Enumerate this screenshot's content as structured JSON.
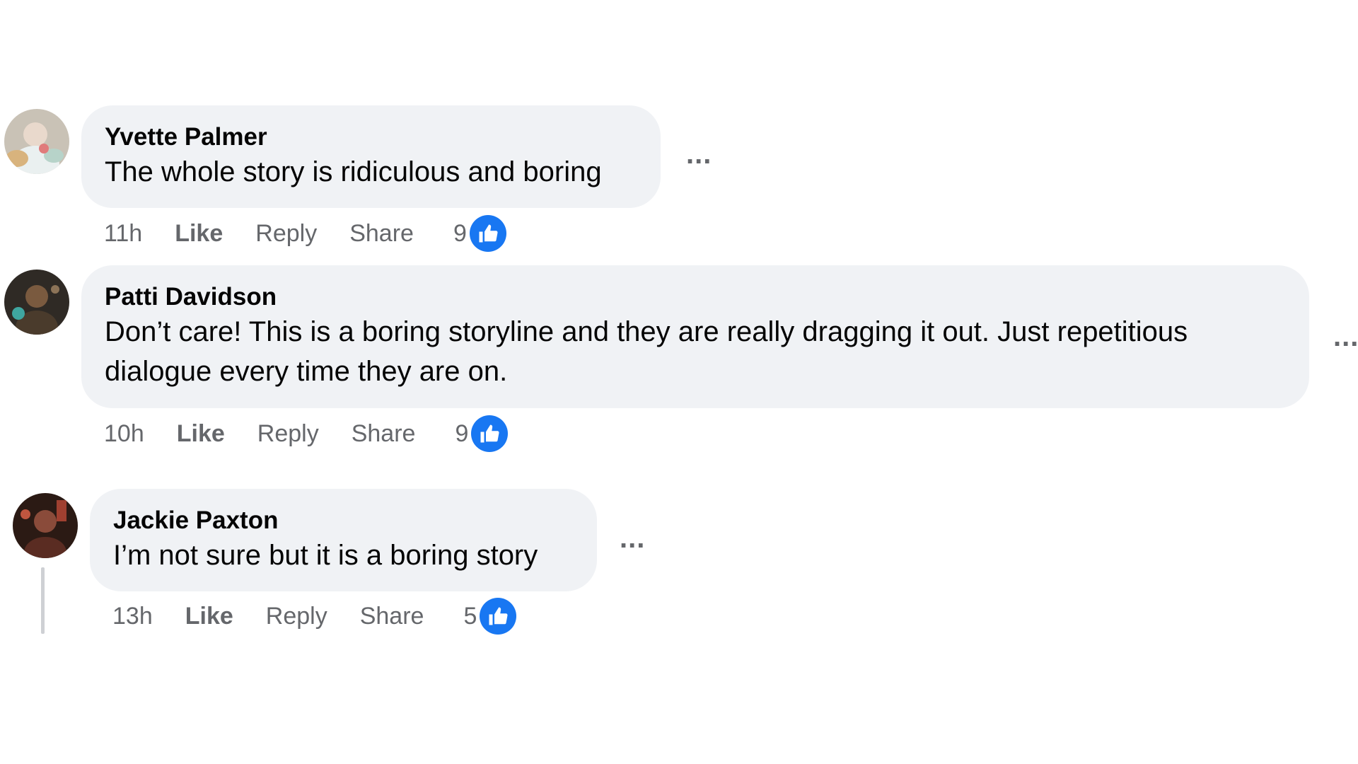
{
  "colors": {
    "bubble_bg": "#f0f2f5",
    "meta_text": "#65676b",
    "like_blue": "#1877f2",
    "thread_line": "#ced0d4"
  },
  "icons": {
    "more": "more-options-icon",
    "reaction": "thumbs-up-icon"
  },
  "comments": [
    {
      "author": "Yvette Palmer",
      "text": "The whole story is ridiculous and boring",
      "time": "11h",
      "like_label": "Like",
      "reply_label": "Reply",
      "share_label": "Share",
      "reaction_count": "9",
      "more_label": "..."
    },
    {
      "author": "Patti Davidson",
      "text": "Don’t care! This is a boring storyline and they are really dragging it out. Just repetitious dialogue every time they are on.",
      "time": "10h",
      "like_label": "Like",
      "reply_label": "Reply",
      "share_label": "Share",
      "reaction_count": "9",
      "more_label": "..."
    },
    {
      "author": "Jackie Paxton",
      "text": "I’m not sure but it is a boring story",
      "time": "13h",
      "like_label": "Like",
      "reply_label": "Reply",
      "share_label": "Share",
      "reaction_count": "5",
      "more_label": "..."
    }
  ]
}
